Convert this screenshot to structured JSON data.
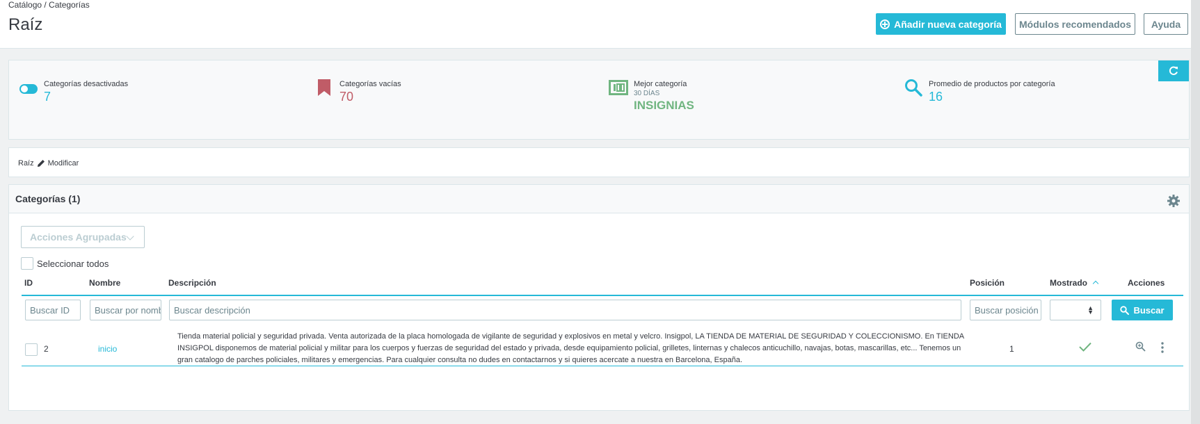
{
  "header": {
    "breadcrumb": "Catálogo  /  Categorías",
    "title": "Raíz",
    "buttons": {
      "add": "Añadir nueva categoría",
      "modules": "Módulos recomendados",
      "help": "Ayuda"
    }
  },
  "kpis": [
    {
      "label": "Categorías desactivadas",
      "value": "7",
      "color": "#25b9d7",
      "icon": "toggle-icon"
    },
    {
      "label": "Categorías vacías",
      "value": "70",
      "color": "#c05c67",
      "icon": "bookmark-icon"
    },
    {
      "label": "Mejor categoría",
      "sub": "30 DÍAS",
      "value": "INSIGNIAS",
      "color": "#70b580",
      "icon": "badge-100-icon"
    },
    {
      "label": "Promedio de productos por categoría",
      "value": "16",
      "color": "#25b9d7",
      "icon": "search-icon"
    }
  ],
  "crumb": {
    "root": "Raíz",
    "edit": "Modificar"
  },
  "list": {
    "title": "Categorías (1)",
    "bulk_actions": "Acciones Agrupadas",
    "select_all": "Seleccionar todos",
    "columns": {
      "id": "ID",
      "name": "Nombre",
      "description": "Descripción",
      "position": "Posición",
      "shown": "Mostrado",
      "actions": "Acciones"
    },
    "filters": {
      "id": "Buscar ID",
      "name": "Buscar por nombre",
      "description": "Buscar descripción",
      "position": "Buscar posición",
      "search_button": "Buscar"
    },
    "rows": [
      {
        "id": "2",
        "name": "inicio",
        "description": "Tienda material policial y seguridad privada. Venta autorizada de la placa homologada de vigilante de seguridad y explosivos en metal y velcro. Insigpol, LA TIENDA DE MATERIAL DE SEGURIDAD Y COLECCIONISMO. En TIENDA INSIGPOL disponemos de material policial y militar para los cuerpos y fuerzas de seguridad del estado y privada, desde equipamiento policial, grilletes, linternas y chalecos anticuchillo, navajas, botas, mascarillas, etc... Tenemos un gran catalogo de parches policiales, militares y emergencias. Para cualquier consulta no dudes en contactarnos y si quieres acercate a  nuestra en Barcelona, España.",
        "position": "1"
      }
    ]
  },
  "colors": {
    "accent": "#25b9d7",
    "danger": "#c05c67",
    "success": "#70b580"
  }
}
